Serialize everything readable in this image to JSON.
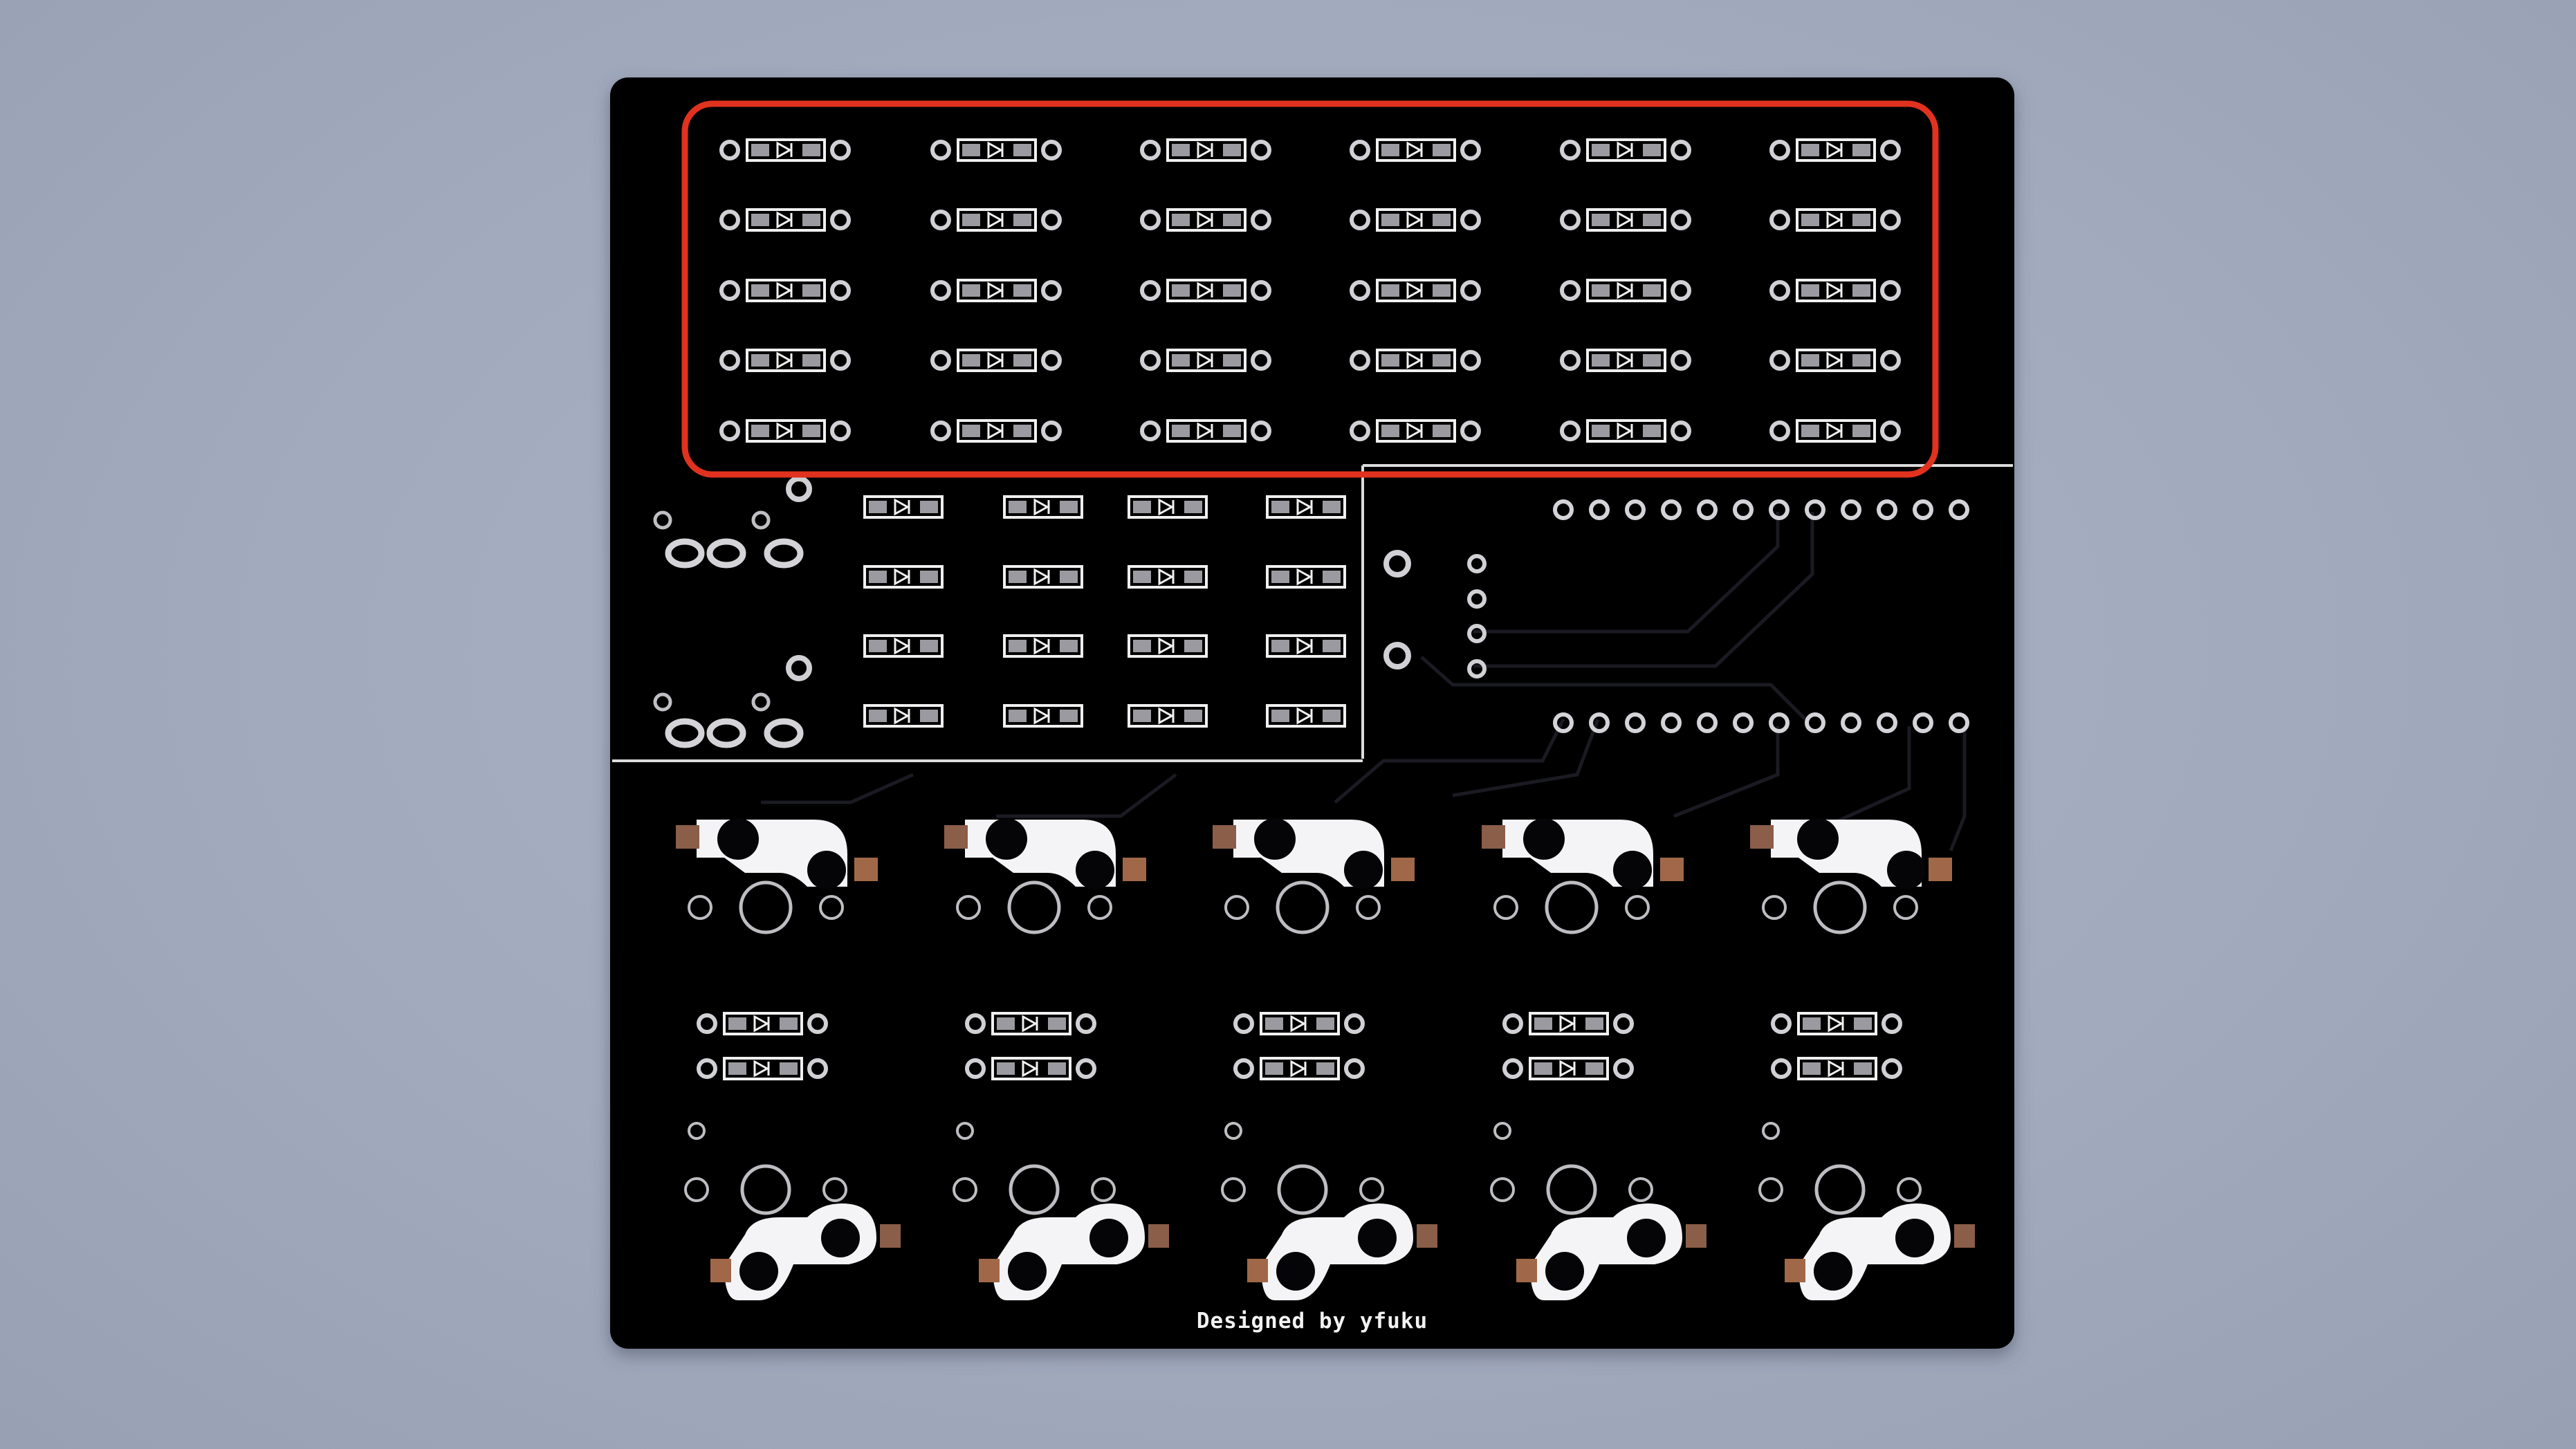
{
  "photo": {
    "subject": "keyboard PCB",
    "board_color": "#030305",
    "silkscreen_color": "#ffffff",
    "highlight_color": "#e0321f",
    "background_color": "#a4acbf",
    "pad_color": "#d8d8dc",
    "copper_color": "#a06848"
  },
  "silkscreen": {
    "credit_text": "Designed by yfuku"
  },
  "highlight": {
    "label": "diode array (6 x 5)",
    "rows": 5,
    "cols": 6
  },
  "diode_grid_small": {
    "rows": 4,
    "cols": 4
  },
  "switch_footprints": {
    "count": 5
  },
  "header_pins": {
    "per_row": 12,
    "rows": 2
  }
}
